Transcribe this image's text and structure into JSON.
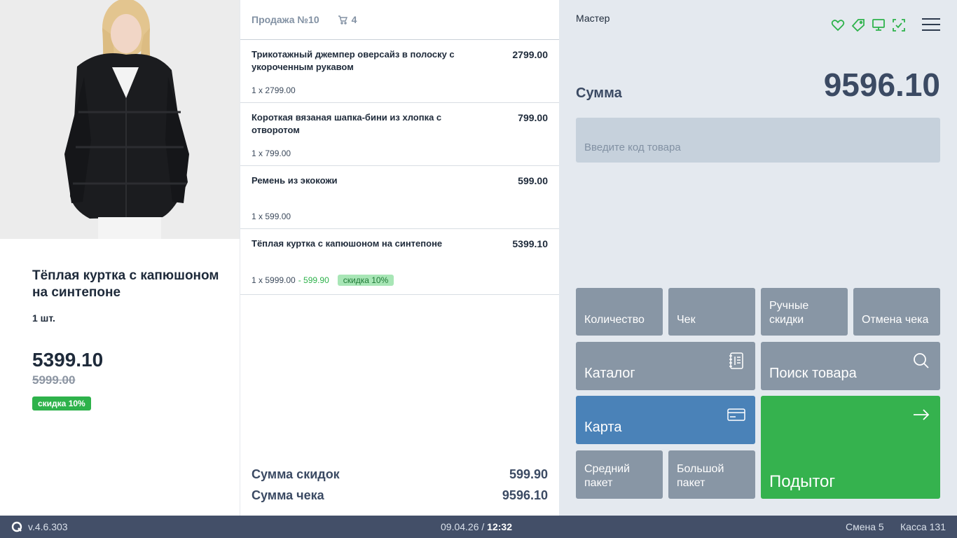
{
  "product": {
    "name": "Тёплая куртка с капюшоном на синтепоне",
    "qty": "1 шт.",
    "price": "5399.10",
    "old_price": "5999.00",
    "discount_badge": "скидка 10%"
  },
  "receipt": {
    "title": "Продажа №10",
    "cart_count": "4",
    "items": [
      {
        "name": "Трикотажный джемпер оверсайз в полоску с укороченным рукавом",
        "total": "2799.00",
        "calc": "1 x 2799.00"
      },
      {
        "name": "Короткая вязаная шапка-бини из хлопка с отворотом",
        "total": "799.00",
        "calc": "1 x 799.00"
      },
      {
        "name": "Ремень из экокожи",
        "total": "599.00",
        "calc": "1 x 599.00"
      },
      {
        "name": "Тёплая куртка с капюшоном на синтепоне",
        "total": "5399.10",
        "calc": "1 x 5999.00",
        "minus": "- 599.90",
        "discount": "скидка 10%"
      }
    ],
    "summary": {
      "discount_label": "Сумма скидок",
      "discount_value": "599.90",
      "total_label": "Сумма чека",
      "total_value": "9596.10"
    }
  },
  "panel": {
    "user": "Мастер",
    "sum_label": "Сумма",
    "sum_value": "9596.10",
    "code_placeholder": "Введите код товара",
    "status_icons": [
      "heart-icon",
      "tag-icon",
      "terminal-icon",
      "scan-icon"
    ],
    "buttons": {
      "quantity": "Количество",
      "receipt": "Чек",
      "manual_discounts": "Ручные скидки",
      "cancel_receipt": "Отмена чека",
      "catalog": "Каталог",
      "search": "Поиск товара",
      "card": "Карта",
      "subtotal": "Подытог",
      "medium_bag": "Средний пакет",
      "large_bag": "Большой пакет"
    },
    "colors": {
      "accent_green": "#35b24e",
      "accent_blue": "#4a82b8",
      "button_gray": "#8896a5",
      "status_green": "#2eb24b"
    }
  },
  "statusbar": {
    "version": "v.4.6.303",
    "date": "09.04.26",
    "separator": "/",
    "time": "12:32",
    "shift": "Смена 5",
    "kassa": "Касса 131"
  }
}
